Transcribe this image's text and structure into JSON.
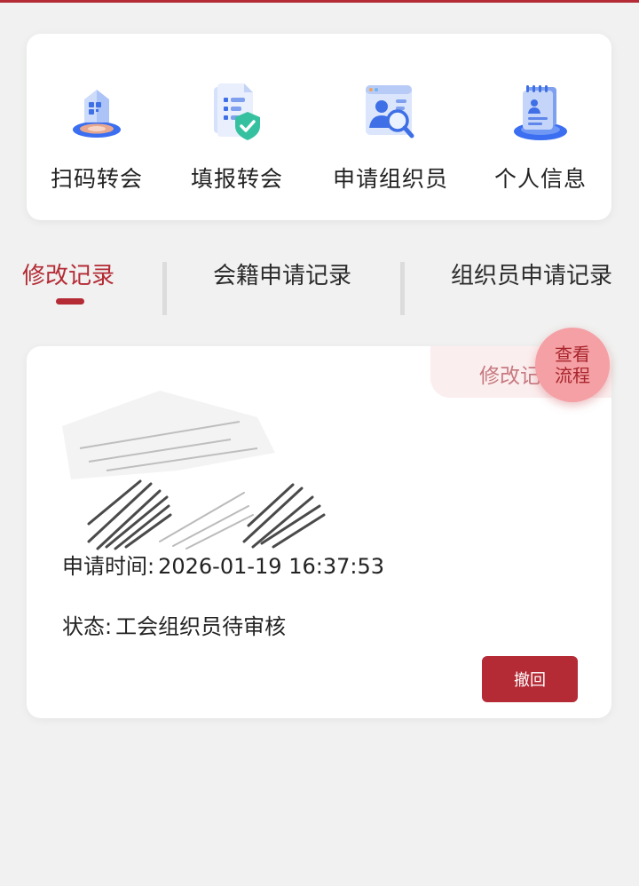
{
  "quick_actions": [
    {
      "label": "扫码转会",
      "icon": "scan-transfer-icon"
    },
    {
      "label": "填报转会",
      "icon": "form-transfer-icon"
    },
    {
      "label": "申请组织员",
      "icon": "apply-organizer-icon"
    },
    {
      "label": "个人信息",
      "icon": "personal-info-icon"
    }
  ],
  "tabs": [
    {
      "label": "修改记录",
      "active": true
    },
    {
      "label": "会籍申请记录",
      "active": false
    },
    {
      "label": "组织员申请记录",
      "active": false
    }
  ],
  "record": {
    "ribbon_label": "修改记录",
    "apply_time_label": "申请时间:",
    "apply_time_value": "2026-01-19 16:37:53",
    "status_label": "状态:",
    "status_value": "工会组织员待审核",
    "revoke_label": "撤回"
  },
  "flow_button": {
    "line1": "查看",
    "line2": "流程"
  },
  "colors": {
    "accent": "#b42a35",
    "background": "#f0f1f0",
    "ribbon": "#fbeeee",
    "flow_button": "#f4a0a4"
  }
}
